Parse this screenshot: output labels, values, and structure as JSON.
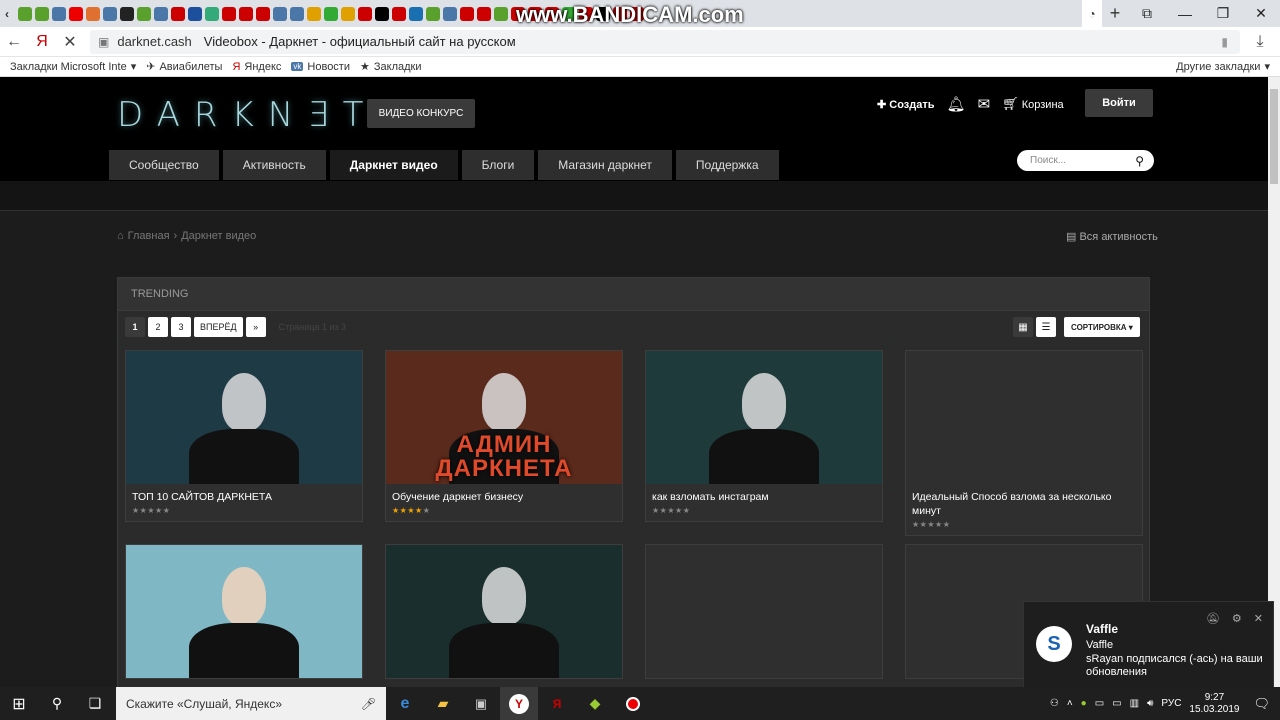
{
  "browser": {
    "watermark": "www.BANDICAM.com",
    "address_domain": "darknet.cash",
    "address_title": "Videobox - Даркнет - официальный сайт на русском",
    "bookmarks": [
      "Закладки Microsoft Inte",
      "Авиабилеты",
      "Яндекс",
      "Новости",
      "Закладки"
    ],
    "other_bookmarks": "Другие закладки"
  },
  "site": {
    "logo": "DARKN∃T",
    "contest_button": "ВИДЕО КОНКУРС",
    "create": "Создать",
    "cart": "Корзина",
    "login": "Войти",
    "nav": [
      "Сообщество",
      "Активность",
      "Даркнет видео",
      "Блоги",
      "Магазин даркнет",
      "Поддержка"
    ],
    "search_placeholder": "Поиск...",
    "breadcrumb_home": "Главная",
    "breadcrumb_current": "Даркнет видео",
    "all_activity": "Вся активность",
    "panel_title": "TRENDING",
    "pages": [
      "1",
      "2",
      "3"
    ],
    "next_label": "ВПЕРЁД",
    "last_label": "»",
    "page_info": "Страница 1 из 3",
    "sort_label": "СОРТИРОВКА ▾",
    "cards": [
      {
        "title": "ТОП 10 САЙТОВ ДАРКНЕТА",
        "rating": 0,
        "thumb_color": "#1e3a44"
      },
      {
        "title": "Обучение даркнет бизнесу",
        "rating": 4,
        "thumb_color": "#5a2a1c",
        "thumb_text": "АДМИН ДАРКНЕТА"
      },
      {
        "title": "как взломать инстаграм",
        "rating": 0,
        "thumb_color": "#1f3a3a"
      },
      {
        "title": "Идеальный Способ взлома за несколько минут",
        "rating": 0,
        "thumb_color": "#2f2f2f"
      },
      {
        "title": "",
        "rating": 0,
        "thumb_color": "#7fb8c4"
      },
      {
        "title": "",
        "rating": 0,
        "thumb_color": "#1b2e2e"
      },
      {
        "title": "",
        "rating": 0,
        "thumb_color": "#2f2f2f"
      },
      {
        "title": "",
        "rating": 0,
        "thumb_color": "#2f2f2f"
      }
    ]
  },
  "taskbar": {
    "search_text": "Скажите «Слушай, Яндекс»",
    "lang": "РУС",
    "time": "9:27",
    "date": "15.03.2019"
  },
  "notification": {
    "title": "Vaffle",
    "subtitle": "Vaffle",
    "message": "sRayan подписался (-ась) на ваши обновления"
  }
}
